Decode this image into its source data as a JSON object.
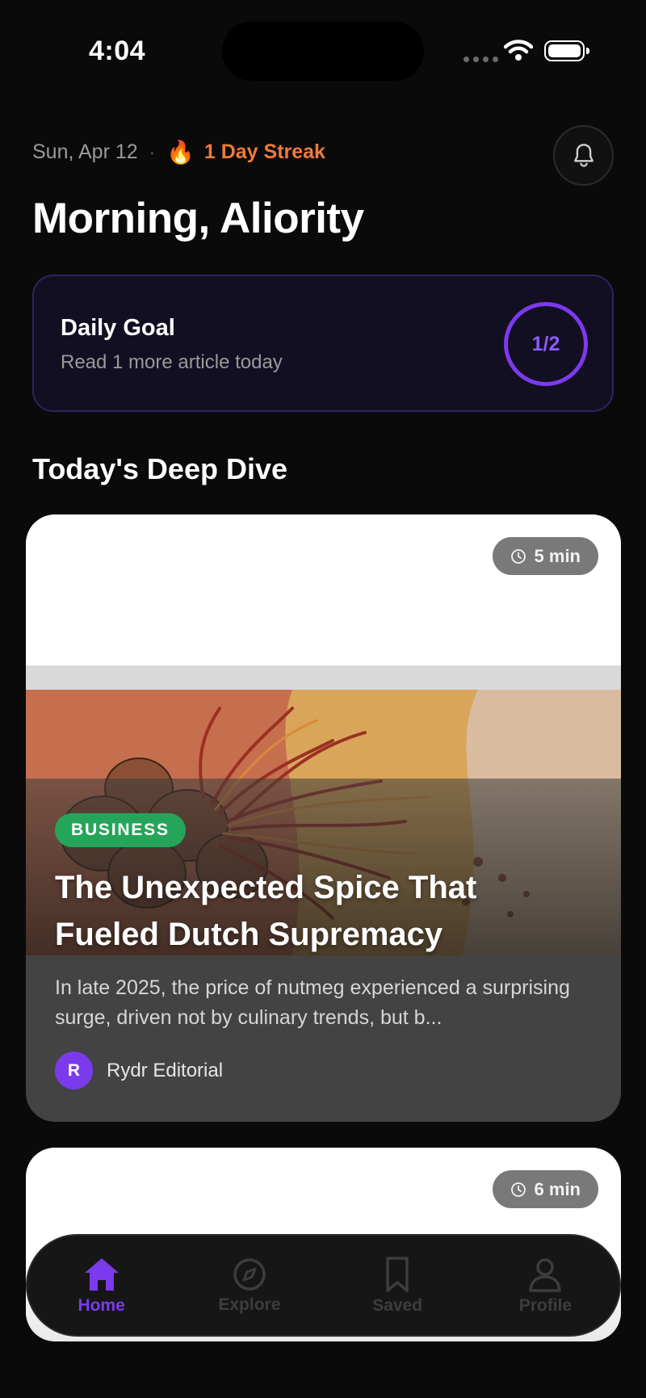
{
  "status_bar": {
    "time": "4:04"
  },
  "header": {
    "date": "Sun, Apr 12",
    "separator": "·",
    "streak_icon": "🔥",
    "streak": "1 Day Streak",
    "greeting": "Morning, Aliority",
    "notification_icon": "bell-icon"
  },
  "daily_goal": {
    "title": "Daily Goal",
    "subtitle": "Read 1 more article today",
    "progress_text": "1/2",
    "progress": 0.5
  },
  "section": {
    "title": "Today's Deep Dive"
  },
  "articles": [
    {
      "read_time": "5 min",
      "category": "BUSINESS",
      "title": "The Unexpected Spice That Fueled Dutch Supremacy",
      "excerpt": "In late 2025, the price of nutmeg experienced a surprising surge, driven not by culinary trends, but b...",
      "author_initial": "R",
      "author": "Rydr Editorial"
    },
    {
      "read_time": "6 min"
    }
  ],
  "tabbar": {
    "items": [
      {
        "label": "Home",
        "icon": "home-icon",
        "active": true
      },
      {
        "label": "Explore",
        "icon": "compass-icon",
        "active": false
      },
      {
        "label": "Saved",
        "icon": "bookmark-icon",
        "active": false
      },
      {
        "label": "Profile",
        "icon": "profile-icon",
        "active": false
      }
    ]
  },
  "colors": {
    "accent": "#7c3aed",
    "streak": "#f07a3a",
    "category_business": "#25a55a",
    "background": "#0a0a0a"
  }
}
